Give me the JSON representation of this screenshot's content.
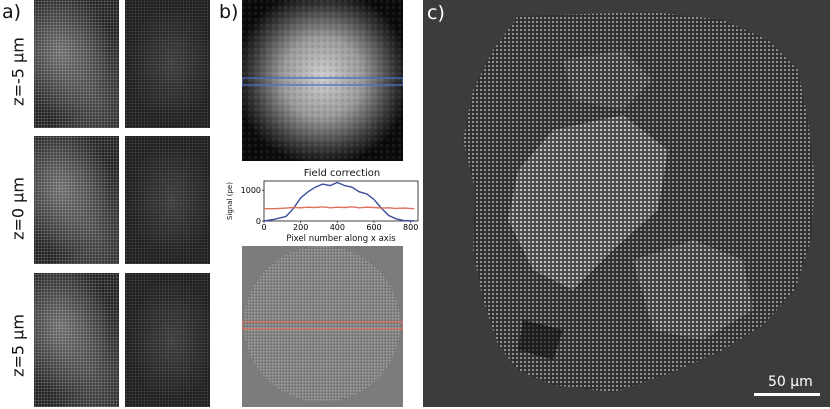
{
  "labels": {
    "a": "a)",
    "b": "b)",
    "c": "c)"
  },
  "panel_a": {
    "rows": [
      "z=-5 µm",
      "z=0 µm",
      "z=5 µm"
    ]
  },
  "panel_b": {
    "chart_data": {
      "type": "line",
      "title": "Field correction",
      "xlabel": "Pixel number along x axis",
      "ylabel": "Signal (pe)",
      "xlim": [
        0,
        840
      ],
      "ylim": [
        0,
        1300
      ],
      "xticks": [
        0,
        200,
        400,
        600,
        800
      ],
      "yticks": [
        0,
        1000
      ],
      "grid": false,
      "series": [
        {
          "color": "#3b4e9c",
          "x": [
            0,
            60,
            120,
            160,
            200,
            240,
            280,
            320,
            360,
            400,
            440,
            480,
            520,
            560,
            600,
            640,
            680,
            720,
            760,
            820
          ],
          "y": [
            0,
            60,
            150,
            400,
            750,
            950,
            1100,
            1200,
            1150,
            1250,
            1150,
            1100,
            950,
            880,
            700,
            420,
            180,
            70,
            20,
            0
          ]
        },
        {
          "color": "#e07060",
          "x": [
            0,
            60,
            120,
            160,
            200,
            240,
            280,
            320,
            360,
            400,
            440,
            480,
            520,
            560,
            600,
            640,
            680,
            720,
            760,
            820
          ],
          "y": [
            400,
            400,
            420,
            440,
            430,
            450,
            440,
            460,
            430,
            450,
            440,
            460,
            430,
            450,
            440,
            420,
            430,
            410,
            420,
            400
          ]
        }
      ]
    }
  },
  "panel_c": {
    "scale_bar": "50 µm"
  },
  "colors": {
    "band_blue": "#4a6cc4",
    "band_red": "#e07060"
  }
}
